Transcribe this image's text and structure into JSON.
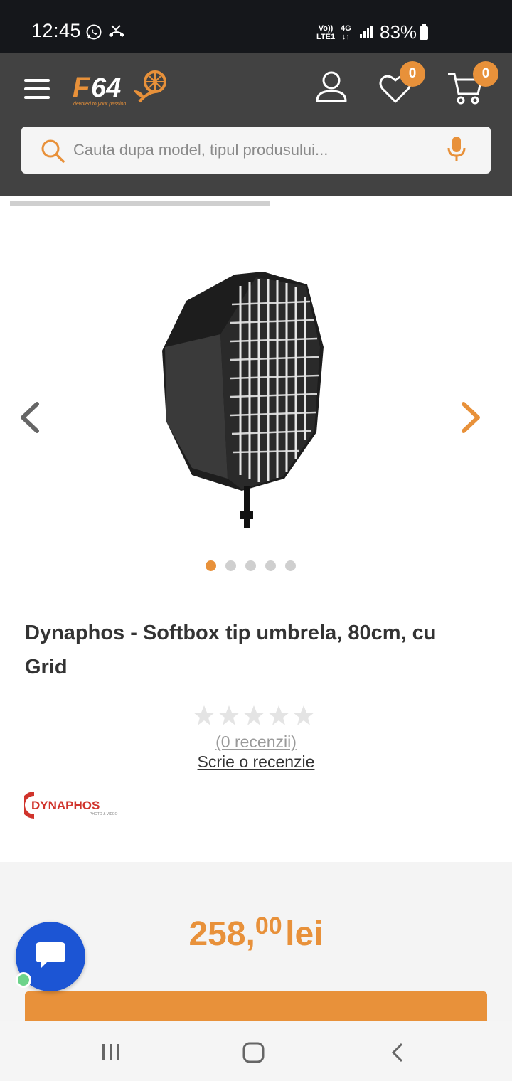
{
  "status_bar": {
    "time": "12:45",
    "network_top": "Vo))",
    "network_bottom": "LTE1",
    "data_type": "4G",
    "battery": "83%"
  },
  "header": {
    "logo_text": "F64",
    "logo_tagline": "devoted to your passion",
    "wishlist_count": "0",
    "cart_count": "0",
    "accent_color": "#e8913a"
  },
  "search": {
    "placeholder": "Cauta dupa model, tipul produsului..."
  },
  "gallery": {
    "slide_count": 5,
    "active_slide": 1
  },
  "product": {
    "title": "Dynaphos - Softbox tip umbrela, 80cm, cu Grid",
    "rating": 0,
    "reviews_label": "(0 recenzii)",
    "write_review_label": "Scrie o recenzie",
    "brand": "DYNAPHOS",
    "brand_sub": "PHOTO & VIDEO"
  },
  "price": {
    "integer": "258,",
    "cents": "00",
    "currency": "lei"
  }
}
